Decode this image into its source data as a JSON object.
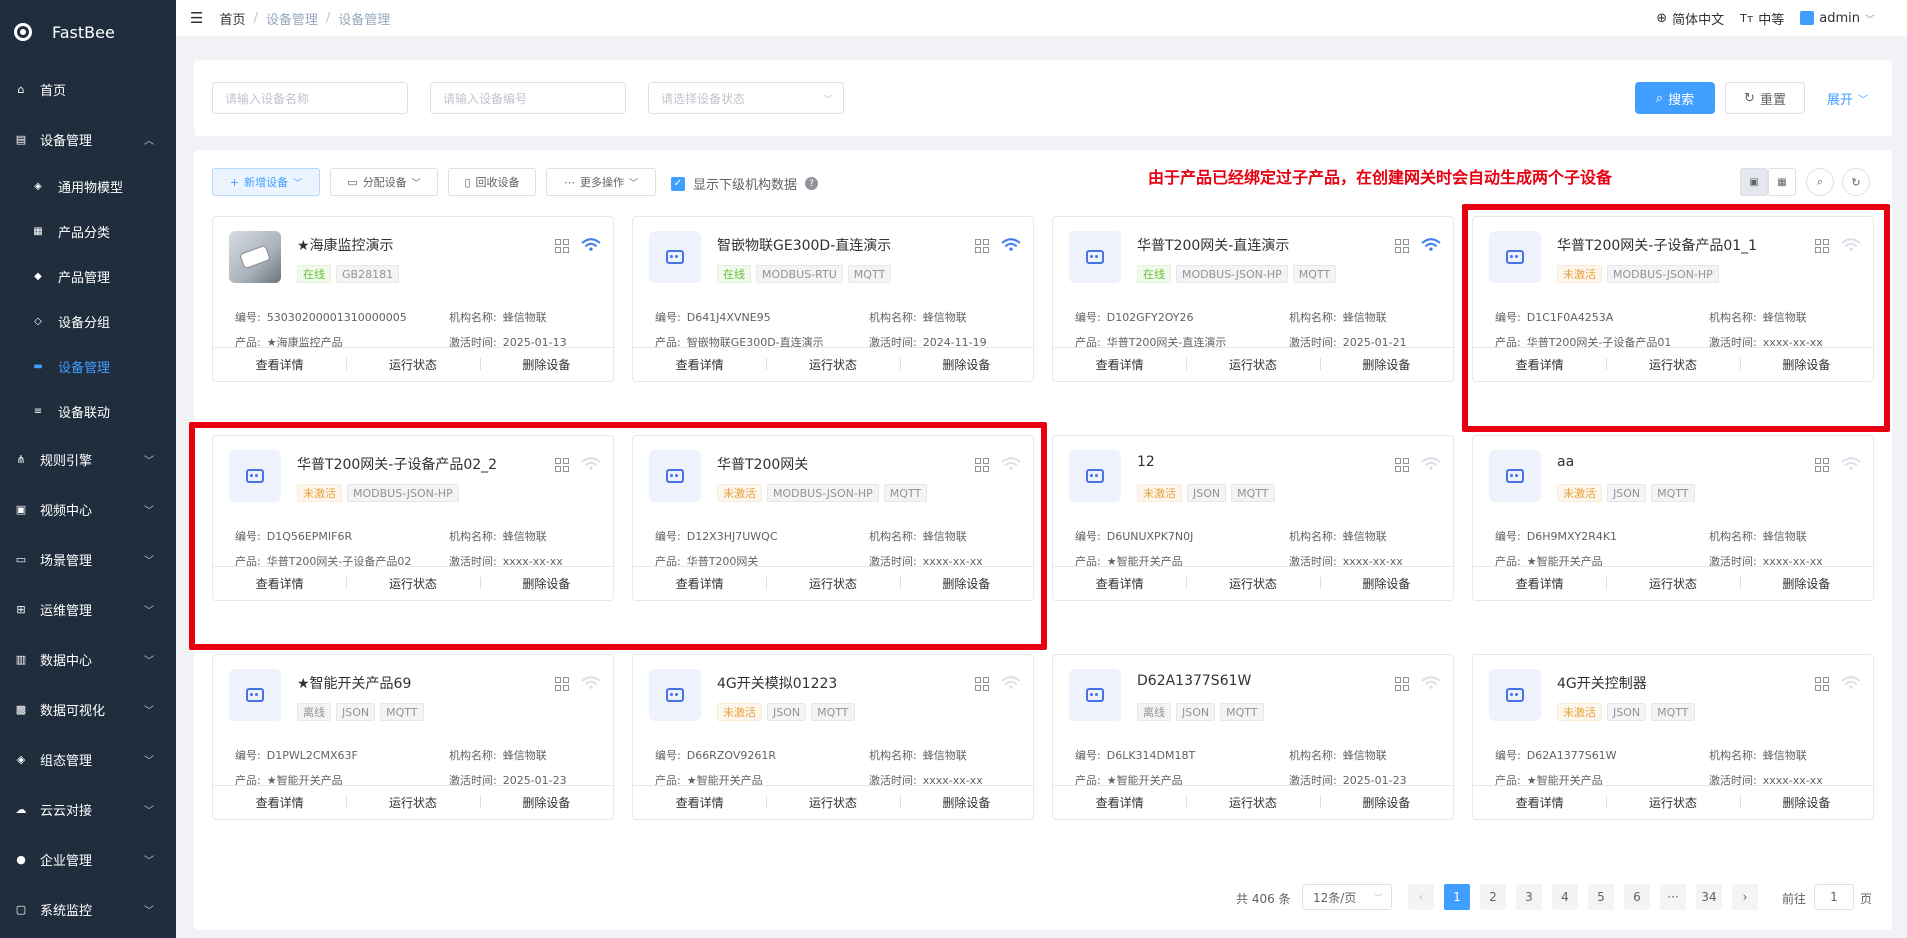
{
  "app": {
    "name": "FastBee"
  },
  "sidebar": {
    "items": [
      {
        "label": "首页",
        "icon": "home-icon"
      },
      {
        "label": "设备管理",
        "icon": "device-icon",
        "expanded": true
      },
      {
        "label": "规则引擎",
        "icon": "rules-icon"
      },
      {
        "label": "视频中心",
        "icon": "video-icon"
      },
      {
        "label": "场景管理",
        "icon": "scene-icon"
      },
      {
        "label": "运维管理",
        "icon": "ops-icon"
      },
      {
        "label": "数据中心",
        "icon": "data-icon"
      },
      {
        "label": "数据可视化",
        "icon": "visual-icon"
      },
      {
        "label": "组态管理",
        "icon": "config-icon"
      },
      {
        "label": "云云对接",
        "icon": "cloud-icon"
      },
      {
        "label": "企业管理",
        "icon": "enterprise-icon"
      },
      {
        "label": "系统监控",
        "icon": "monitor-icon"
      }
    ],
    "sub_items": [
      {
        "label": "通用物模型"
      },
      {
        "label": "产品分类"
      },
      {
        "label": "产品管理"
      },
      {
        "label": "设备分组"
      },
      {
        "label": "设备管理",
        "active": true
      },
      {
        "label": "设备联动"
      }
    ]
  },
  "header": {
    "breadcrumb": [
      "首页",
      "设备管理",
      "设备管理"
    ],
    "language": "简体中文",
    "font_size": "中等",
    "user": "admin"
  },
  "search": {
    "name_placeholder": "请输入设备名称",
    "serial_placeholder": "请输入设备编号",
    "status_placeholder": "请选择设备状态",
    "search_label": "搜索",
    "reset_label": "重置",
    "expand_label": "展开"
  },
  "toolbar": {
    "add_label": "新增设备",
    "assign_label": "分配设备",
    "recycle_label": "回收设备",
    "more_label": "更多操作",
    "show_sub_label": "显示下级机构数据",
    "annotation": "由于产品已经绑定过子产品，在创建网关时会自动生成两个子设备"
  },
  "card_labels": {
    "serial": "编号:",
    "org": "机构名称:",
    "product": "产品:",
    "activated": "激活时间:",
    "detail": "查看详情",
    "status": "运行状态",
    "delete": "删除设备"
  },
  "devices": [
    {
      "name": "★海康监控演示",
      "tags": [
        "在线",
        "GB28181"
      ],
      "status": "online",
      "serial": "53030200001310000005",
      "org": "蜂信物联",
      "product": "★海康监控产品",
      "activated": "2025-01-13",
      "photo": true,
      "wifi": true
    },
    {
      "name": "智嵌物联GE300D-直连演示",
      "tags": [
        "在线",
        "MODBUS-RTU",
        "MQTT"
      ],
      "status": "online",
      "serial": "D641J4XVNE95",
      "org": "蜂信物联",
      "product": "智嵌物联GE300D-直连演示",
      "activated": "2024-11-19",
      "wifi": true
    },
    {
      "name": "华普T200网关-直连演示",
      "tags": [
        "在线",
        "MODBUS-JSON-HP",
        "MQTT"
      ],
      "status": "online",
      "serial": "D102GFY2OY26",
      "org": "蜂信物联",
      "product": "华普T200网关-直连演示",
      "activated": "2025-01-21",
      "wifi": true
    },
    {
      "name": "华普T200网关-子设备产品01_1",
      "tags": [
        "未激活",
        "MODBUS-JSON-HP"
      ],
      "status": "inactive",
      "serial": "D1C1F0A4253A",
      "org": "蜂信物联",
      "product": "华普T200网关-子设备产品01",
      "activated": "xxxx-xx-xx",
      "wifi": false
    },
    {
      "name": "华普T200网关-子设备产品02_2",
      "tags": [
        "未激活",
        "MODBUS-JSON-HP"
      ],
      "status": "inactive",
      "serial": "D1Q56EPMIF6R",
      "org": "蜂信物联",
      "product": "华普T200网关-子设备产品02",
      "activated": "xxxx-xx-xx",
      "wifi": false
    },
    {
      "name": "华普T200网关",
      "tags": [
        "未激活",
        "MODBUS-JSON-HP",
        "MQTT"
      ],
      "status": "inactive",
      "serial": "D12X3HJ7UWQC",
      "org": "蜂信物联",
      "product": "华普T200网关",
      "activated": "xxxx-xx-xx",
      "wifi": false,
      "gateway": true
    },
    {
      "name": "12",
      "tags": [
        "未激活",
        "JSON",
        "MQTT"
      ],
      "status": "inactive",
      "serial": "D6UNUXPK7N0J",
      "org": "蜂信物联",
      "product": "★智能开关产品",
      "activated": "xxxx-xx-xx",
      "wifi": false
    },
    {
      "name": "aa",
      "tags": [
        "未激活",
        "JSON",
        "MQTT"
      ],
      "status": "inactive",
      "serial": "D6H9MXY2R4K1",
      "org": "蜂信物联",
      "product": "★智能开关产品",
      "activated": "xxxx-xx-xx",
      "wifi": false
    },
    {
      "name": "★智能开关产品69",
      "tags": [
        "离线",
        "JSON",
        "MQTT"
      ],
      "status": "offline",
      "serial": "D1PWL2CMX63F",
      "org": "蜂信物联",
      "product": "★智能开关产品",
      "activated": "2025-01-23",
      "wifi": false
    },
    {
      "name": "4G开关模拟01223",
      "tags": [
        "未激活",
        "JSON",
        "MQTT"
      ],
      "status": "inactive",
      "serial": "D66RZOV9261R",
      "org": "蜂信物联",
      "product": "★智能开关产品",
      "activated": "xxxx-xx-xx",
      "wifi": false
    },
    {
      "name": "D62A1377S61W",
      "tags": [
        "离线",
        "JSON",
        "MQTT"
      ],
      "status": "offline",
      "serial": "D6LK314DM18T",
      "org": "蜂信物联",
      "product": "★智能开关产品",
      "activated": "2025-01-23",
      "wifi": false
    },
    {
      "name": "4G开关控制器",
      "tags": [
        "未激活",
        "JSON",
        "MQTT"
      ],
      "status": "inactive",
      "serial": "D62A1377S61W",
      "org": "蜂信物联",
      "product": "★智能开关产品",
      "activated": "xxxx-xx-xx",
      "wifi": false
    }
  ],
  "pagination": {
    "total": "共 406 条",
    "page_size": "12条/页",
    "pages": [
      "1",
      "2",
      "3",
      "4",
      "5",
      "6",
      "···",
      "34"
    ],
    "current": "1",
    "goto_label": "前往",
    "goto_value": "1",
    "page_unit": "页",
    "prev": "‹",
    "next": "›"
  },
  "colors": {
    "primary": "#409eff",
    "annotation": "#e60012",
    "sidebar": "#1f2d3d"
  }
}
